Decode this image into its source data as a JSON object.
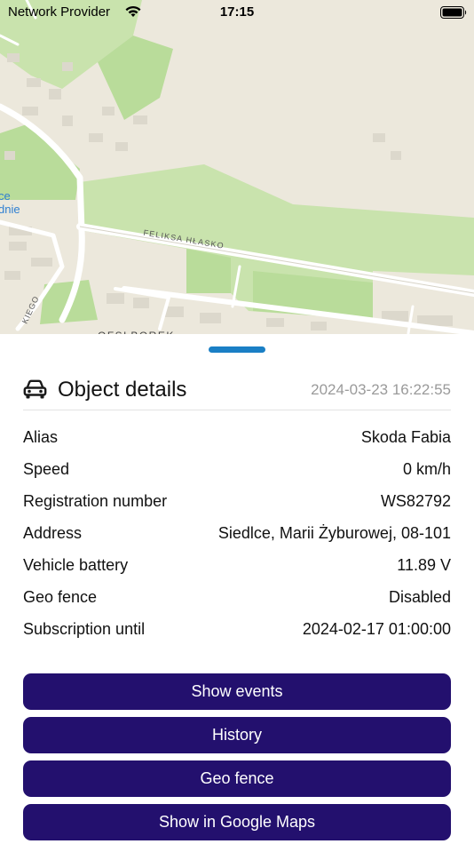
{
  "status_bar": {
    "carrier": "Network Provider",
    "time": "17:15"
  },
  "map": {
    "street_label": "FELIKSA HŁASKO",
    "partial_label_1": "ce",
    "partial_label_2": "dnie",
    "partial_label_3": "KIEGO",
    "partial_label_4": "OFSLBOREK"
  },
  "details": {
    "title": "Object details",
    "timestamp": "2024-03-23 16:22:55",
    "rows": [
      {
        "label": "Alias",
        "value": "Skoda Fabia"
      },
      {
        "label": "Speed",
        "value": "0 km/h"
      },
      {
        "label": "Registration number",
        "value": "WS82792"
      },
      {
        "label": "Address",
        "value": "Siedlce, Marii Żyburowej, 08-101"
      },
      {
        "label": "Vehicle battery",
        "value": "11.89 V"
      },
      {
        "label": "Geo fence",
        "value": "Disabled"
      },
      {
        "label": "Subscription until",
        "value": "2024-02-17 01:00:00"
      }
    ]
  },
  "actions": {
    "show_events": "Show events",
    "history": "History",
    "geo_fence": "Geo fence",
    "show_in_google_maps": "Show in Google Maps"
  },
  "colors": {
    "button_bg": "#23106e",
    "drag_handle": "#1a7fc5",
    "map_park": "#b9dc9a",
    "map_land": "#ece8dc"
  },
  "icons": {
    "header": "car-icon",
    "wifi": "wifi-icon",
    "battery": "battery-icon"
  }
}
